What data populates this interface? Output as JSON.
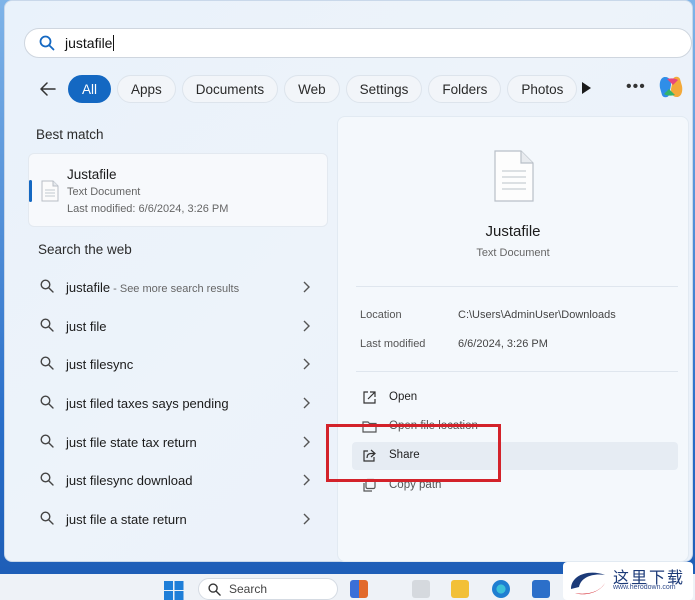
{
  "search": {
    "query": "justafile"
  },
  "filters": [
    "All",
    "Apps",
    "Documents",
    "Web",
    "Settings",
    "Folders",
    "Photos"
  ],
  "sections": {
    "best_match": "Best match",
    "search_web": "Search the web"
  },
  "best_match": {
    "name": "Justafile",
    "type": "Text Document",
    "modified": "Last modified: 6/6/2024, 3:26 PM"
  },
  "web_results": [
    {
      "text": "justafile",
      "sub": " - See more search results"
    },
    {
      "text": "just file",
      "sub": ""
    },
    {
      "text": "just filesync",
      "sub": ""
    },
    {
      "text": "just filed taxes says pending",
      "sub": ""
    },
    {
      "text": "just file state tax return",
      "sub": ""
    },
    {
      "text": "just filesync download",
      "sub": ""
    },
    {
      "text": "just file a state return",
      "sub": ""
    }
  ],
  "preview": {
    "title": "Justafile",
    "subtitle": "Text Document",
    "location_label": "Location",
    "location_value": "C:\\Users\\AdminUser\\Downloads",
    "modified_label": "Last modified",
    "modified_value": "6/6/2024, 3:26 PM",
    "actions": [
      "Open",
      "Open file location",
      "Share",
      "Copy path"
    ]
  },
  "taskbar": {
    "search_placeholder": "Search"
  },
  "watermark": {
    "text": "这里下载",
    "sub": "www.herodown.com"
  },
  "colors": {
    "accent": "#1468c2",
    "highlight": "#d3222a"
  }
}
